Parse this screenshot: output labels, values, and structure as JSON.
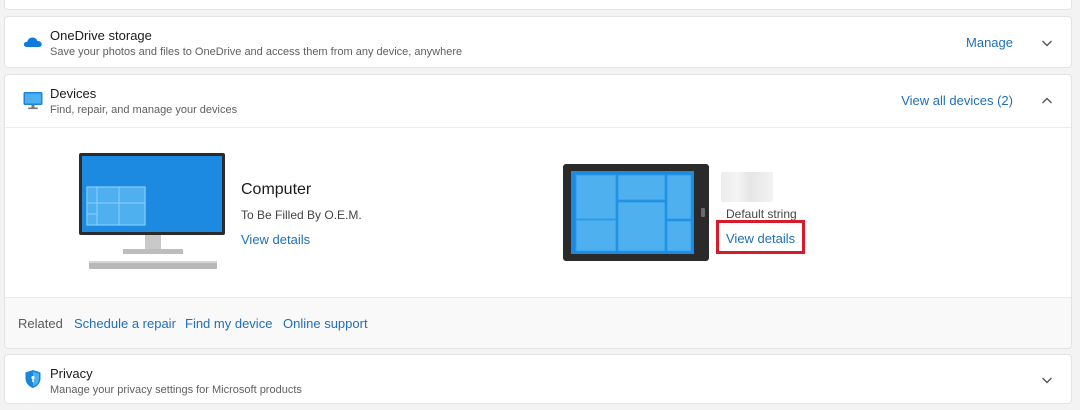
{
  "onedrive": {
    "title": "OneDrive storage",
    "subtitle": "Save your photos and files to OneDrive and access them from any device, anywhere",
    "action": "Manage",
    "icon": "cloud-icon"
  },
  "devices": {
    "title": "Devices",
    "subtitle": "Find, repair, and manage your devices",
    "action": "View all devices (2)",
    "icon": "monitor-icon",
    "items": [
      {
        "name": "Computer",
        "model": "To Be Filled By O.E.M.",
        "link": "View details",
        "icon": "desktop-computer-icon"
      },
      {
        "name": "",
        "model": "Default string",
        "link": "View details",
        "icon": "tablet-icon"
      }
    ]
  },
  "related": {
    "label": "Related",
    "links": [
      "Schedule a repair",
      "Find my device",
      "Online support"
    ]
  },
  "privacy": {
    "title": "Privacy",
    "subtitle": "Manage your privacy settings for Microsoft products",
    "icon": "shield-icon"
  },
  "colors": {
    "link": "#1f6fb8",
    "accent": "#0f7ad8",
    "highlight": "#d81b2a"
  }
}
